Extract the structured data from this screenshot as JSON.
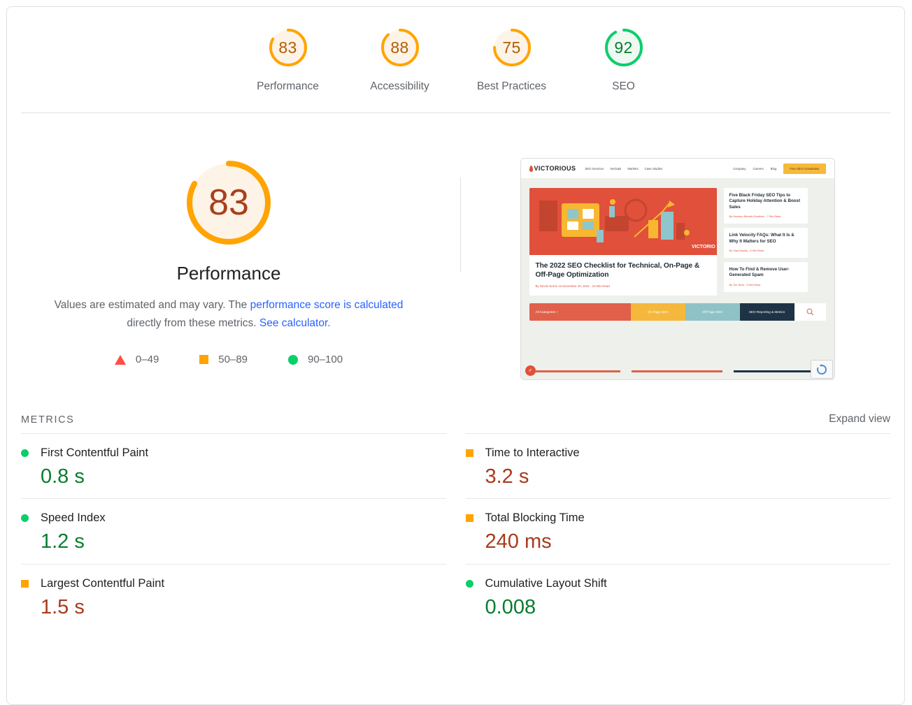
{
  "scores": [
    {
      "value": "83",
      "label": "Performance",
      "pct": 83,
      "color": "#ffa400",
      "track": "#fdf3e7"
    },
    {
      "value": "88",
      "label": "Accessibility",
      "pct": 88,
      "color": "#ffa400",
      "track": "#fdf3e7"
    },
    {
      "value": "75",
      "label": "Best Practices",
      "pct": 75,
      "color": "#ffa400",
      "track": "#fdf3e7"
    },
    {
      "value": "92",
      "label": "SEO",
      "pct": 92,
      "color": "#0cce6b",
      "track": "#eef9f1"
    }
  ],
  "performance": {
    "gauge_value": "83",
    "gauge_pct": 83,
    "gauge_color": "#ffa400",
    "gauge_track": "#fdf3e7",
    "title": "Performance",
    "desc_part1": "Values are estimated and may vary. The ",
    "desc_link1": "performance score is calculated",
    "desc_part2": " directly from these metrics. ",
    "desc_link2": "See calculator.",
    "legend": [
      {
        "shape": "triangle",
        "label": "0–49",
        "color": "#ff4e42"
      },
      {
        "shape": "square",
        "label": "50–89",
        "color": "#ffa400"
      },
      {
        "shape": "circle",
        "label": "90–100",
        "color": "#0cce6b"
      }
    ]
  },
  "thumbnail": {
    "logo": "VICTORIOUS",
    "nav_links": [
      "SEO Services",
      "Verticals",
      "Markets",
      "Case Studies"
    ],
    "nav_right": [
      "Company",
      "Careers",
      "Blog"
    ],
    "cta": "Free SEO consultation",
    "hero_title": "The 2022 SEO Checklist for Technical, On-Page & Off-Page Optimization",
    "hero_byline": "By Nicole Norris on December 29, 2021 - 24 Min Read",
    "hero_watermark": "VICTORIO",
    "side_cards": [
      {
        "title": "Five Black Friday SEO Tips to Capture Holiday Attention & Boost Sales",
        "byline": "By Houston Barnett-Gearhart - 7 Min Read"
      },
      {
        "title": "Link Velocity FAQs: What It Is & Why It Matters for SEO",
        "byline": "By Vlad Danisk - 6 Min Read"
      },
      {
        "title": "How To Find & Remove User-Generated Spam",
        "byline": "By Tim Near - 5 Min Read"
      }
    ],
    "categories": [
      "All Categories   +",
      "On Page SEO",
      "Off Page SEO",
      "SEO Reporting & Metrics"
    ],
    "search_icon": "search-icon",
    "accessibility_icon": "accessibility-icon",
    "recaptcha_icon": "recaptcha-icon"
  },
  "metrics_section": {
    "title": "METRICS",
    "expand_view": "Expand view",
    "left": [
      {
        "status": "circle",
        "name": "First Contentful Paint",
        "value": "0.8 s",
        "value_class": "v-green"
      },
      {
        "status": "circle",
        "name": "Speed Index",
        "value": "1.2 s",
        "value_class": "v-green"
      },
      {
        "status": "square",
        "name": "Largest Contentful Paint",
        "value": "1.5 s",
        "value_class": "v-red"
      }
    ],
    "right": [
      {
        "status": "square",
        "name": "Time to Interactive",
        "value": "3.2 s",
        "value_class": "v-red"
      },
      {
        "status": "square",
        "name": "Total Blocking Time",
        "value": "240 ms",
        "value_class": "v-red"
      },
      {
        "status": "circle",
        "name": "Cumulative Layout Shift",
        "value": "0.008",
        "value_class": "v-green"
      }
    ]
  }
}
